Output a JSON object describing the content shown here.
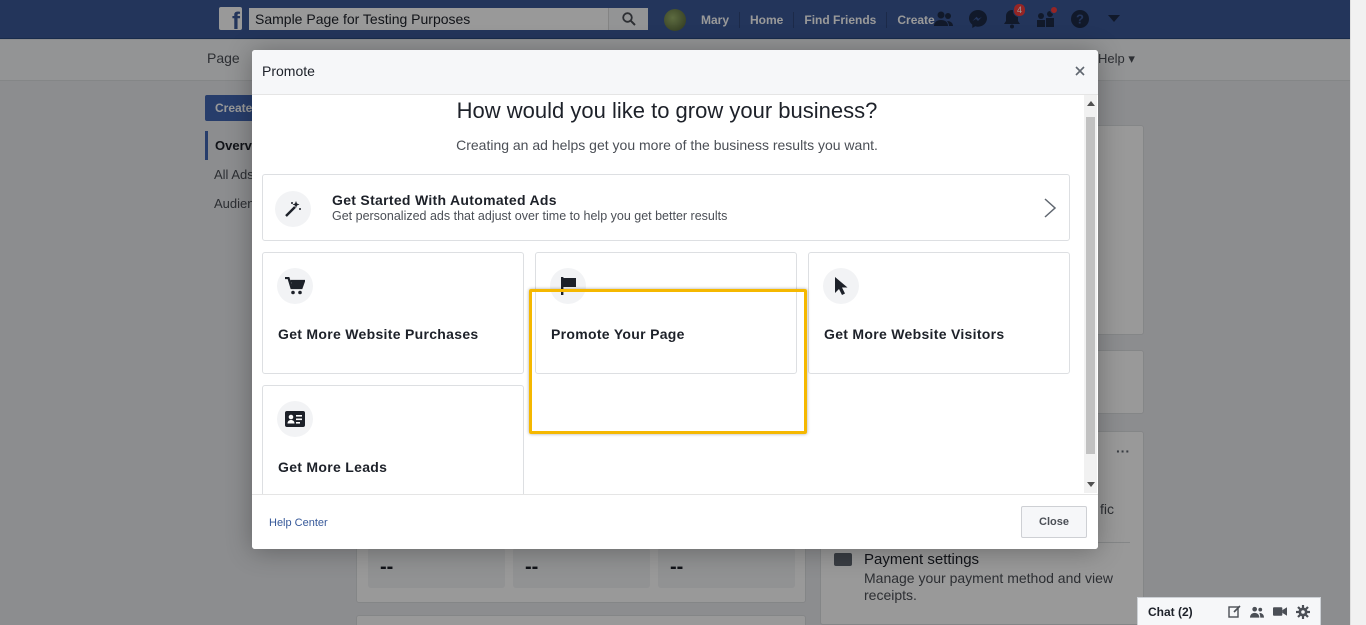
{
  "topbar": {
    "search_value": "Sample Page for Testing Purposes",
    "user_name": "Mary",
    "nav": [
      "Home",
      "Find Friends",
      "Create"
    ],
    "notification_count": "4"
  },
  "subbar": {
    "page_tab": "Page",
    "help": "Help ▾"
  },
  "background": {
    "create_button": "Create",
    "left_nav": [
      "Overvi",
      "All Ads",
      "Audien"
    ],
    "metrics": [
      "--",
      "--",
      "--"
    ],
    "partial_text": "fic",
    "payment_title": "Payment settings",
    "payment_desc": "Manage your payment method and view receipts."
  },
  "chat": {
    "label": "Chat (2)"
  },
  "modal": {
    "title": "Promote",
    "heading": "How would you like to grow your business?",
    "subheading": "Creating an ad helps get you more of the business results you want.",
    "automated": {
      "title": "Get Started With Automated Ads",
      "description": "Get personalized ads that adjust over time to help you get better results"
    },
    "options": [
      {
        "label": "Get More Website Purchases",
        "icon": "cart-icon"
      },
      {
        "label": "Promote Your Page",
        "icon": "flag-icon"
      },
      {
        "label": "Get More Website Visitors",
        "icon": "cursor-icon"
      },
      {
        "label": "Get More Leads",
        "icon": "contact-card-icon"
      }
    ],
    "footer": {
      "help_center": "Help Center",
      "close": "Close"
    }
  },
  "colors": {
    "brand": "#3b5998",
    "highlight": "#f5b800",
    "link": "#365899"
  }
}
